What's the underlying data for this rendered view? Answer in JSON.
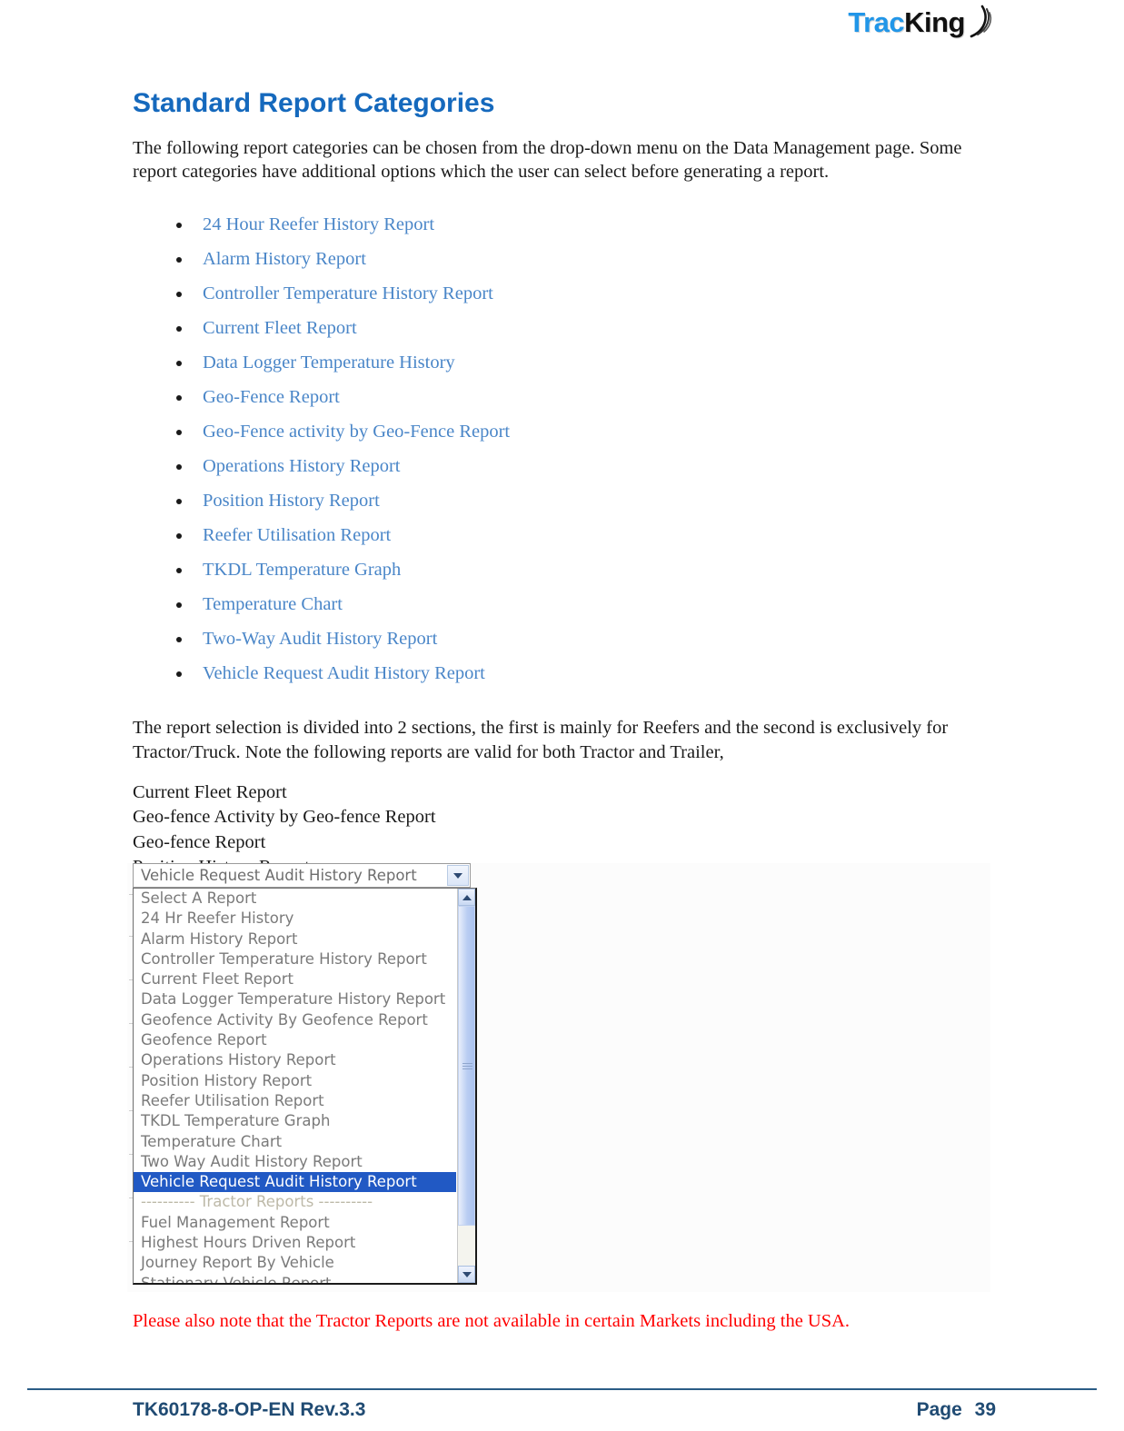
{
  "header": {
    "logo_text_primary": "Trac",
    "logo_text_secondary": "King",
    "logo_icon": "signal-waves-icon"
  },
  "document": {
    "title": "Standard Report Categories",
    "intro_paragraph": "The following report categories can be chosen from the drop-down menu on the Data Management page. Some report categories have additional options which the user can select before generating a report.",
    "report_links": [
      "24 Hour Reefer History Report",
      "Alarm History Report",
      "Controller Temperature History Report",
      "Current Fleet Report",
      "Data Logger Temperature History",
      "Geo-Fence Report",
      "Geo-Fence activity by Geo-Fence Report",
      "Operations History Report",
      "Position History Report",
      "Reefer Utilisation Report",
      "TKDL Temperature Graph",
      "Temperature Chart",
      "Two-Way Audit History Report",
      "Vehicle Request Audit History Report"
    ],
    "section_paragraph": "The report selection is divided into 2 sections, the first is mainly for Reefers and the second is exclusively for Tractor/Truck. Note the following reports are valid for both Tractor and Trailer,",
    "valid_both_reports": [
      "Current Fleet Report",
      "Geo-fence Activity by Geo-fence Report",
      "Geo-fence Report",
      "Position History Report"
    ],
    "red_note": "Please also note that the Tractor Reports are not available in certain Markets including the USA."
  },
  "screenshot": {
    "combo": {
      "selected_value": "Vehicle Request Audit History Report",
      "arrow_icon": "chevron-down-icon"
    },
    "options": [
      {
        "label": "Select A Report",
        "selected": false,
        "separator": false
      },
      {
        "label": "24 Hr Reefer History",
        "selected": false,
        "separator": false
      },
      {
        "label": "Alarm History Report",
        "selected": false,
        "separator": false
      },
      {
        "label": "Controller Temperature History Report",
        "selected": false,
        "separator": false
      },
      {
        "label": "Current Fleet Report",
        "selected": false,
        "separator": false
      },
      {
        "label": "Data Logger Temperature History Report",
        "selected": false,
        "separator": false
      },
      {
        "label": "Geofence Activity By Geofence Report",
        "selected": false,
        "separator": false
      },
      {
        "label": "Geofence Report",
        "selected": false,
        "separator": false
      },
      {
        "label": "Operations History Report",
        "selected": false,
        "separator": false
      },
      {
        "label": "Position History Report",
        "selected": false,
        "separator": false
      },
      {
        "label": "Reefer Utilisation Report",
        "selected": false,
        "separator": false
      },
      {
        "label": "TKDL Temperature Graph",
        "selected": false,
        "separator": false
      },
      {
        "label": "Temperature Chart",
        "selected": false,
        "separator": false
      },
      {
        "label": "Two Way Audit History Report",
        "selected": false,
        "separator": false
      },
      {
        "label": "Vehicle Request Audit History Report",
        "selected": true,
        "separator": false
      },
      {
        "label": "---------- Tractor Reports ----------",
        "selected": false,
        "separator": true
      },
      {
        "label": "Fuel Management Report",
        "selected": false,
        "separator": false
      },
      {
        "label": "Highest Hours Driven Report",
        "selected": false,
        "separator": false
      },
      {
        "label": "Journey Report By Vehicle",
        "selected": false,
        "separator": false
      },
      {
        "label": "Stationary Vehicle Report",
        "selected": false,
        "separator": false
      }
    ],
    "scrollbar": {
      "up_icon": "chevron-up-icon",
      "down_icon": "chevron-down-icon",
      "grip_icon": "scrollbar-grip-icon"
    }
  },
  "footer": {
    "doc_code": "TK60178-8-OP-EN Rev.3.3",
    "page_label": "Page",
    "page_number": "39"
  },
  "colors": {
    "title_blue": "#1569bd",
    "link_blue": "#4a86c8",
    "note_red": "#ff0000",
    "footer_blue": "#204b73",
    "selection_blue": "#2159c4"
  }
}
